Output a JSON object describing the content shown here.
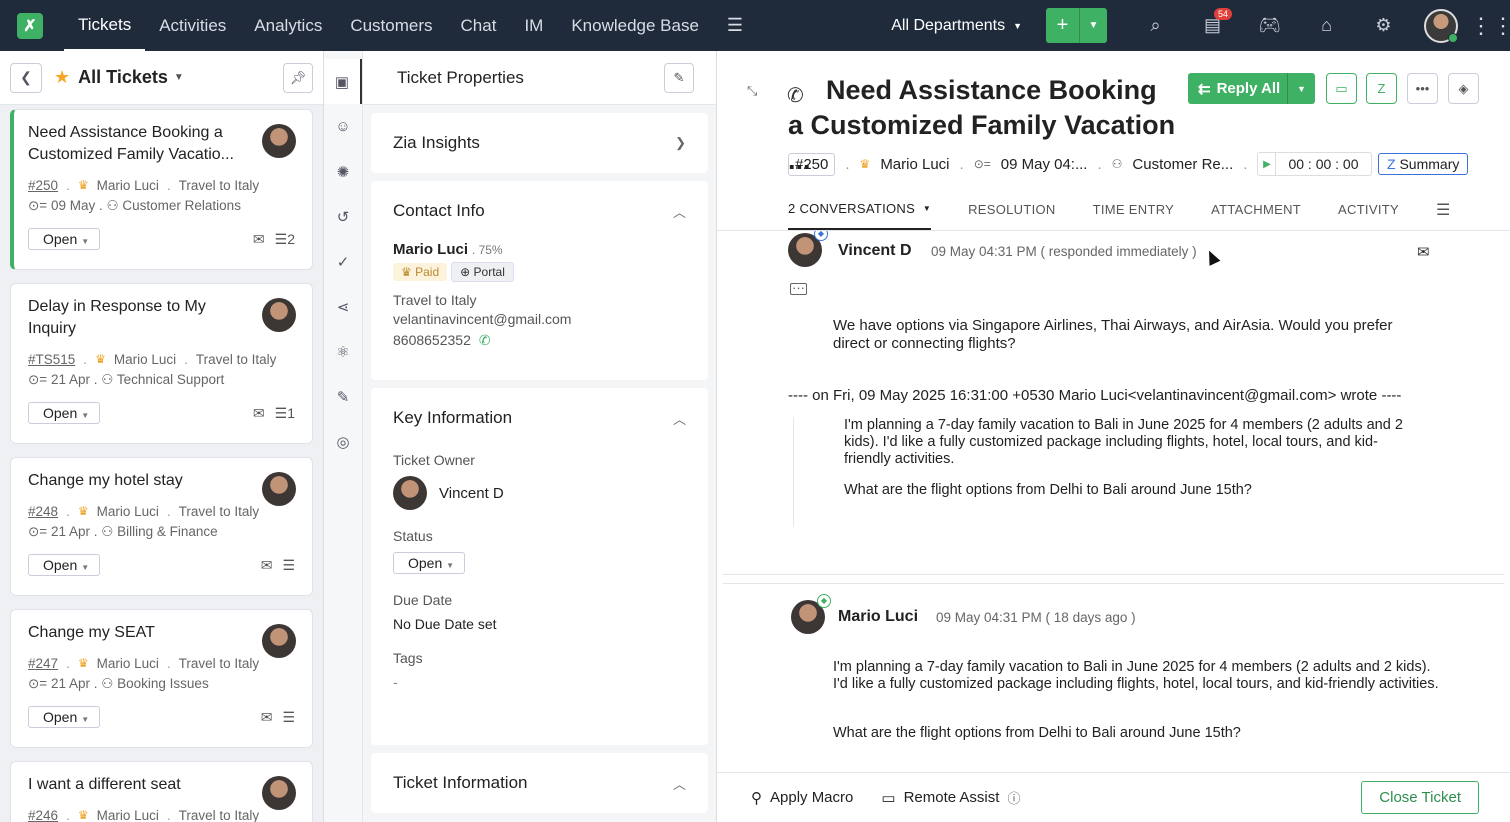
{
  "topbar": {
    "tabs": [
      "Tickets",
      "Activities",
      "Analytics",
      "Customers",
      "Chat",
      "IM",
      "Knowledge Base"
    ],
    "department": "All Departments",
    "notification_count": "54"
  },
  "list": {
    "title": "All Tickets",
    "tickets": [
      {
        "title": "Need Assistance Booking a Customized Family Vacatio...",
        "id": "#250",
        "contact": "Mario Luci",
        "account": "Travel to Italy",
        "date": "09 May",
        "dept": "Customer Relations",
        "status": "Open",
        "count": "2"
      },
      {
        "title": "Delay in Response to My Inquiry",
        "id": "#TS515",
        "contact": "Mario Luci",
        "account": "Travel to Italy",
        "date": "21 Apr",
        "dept": "Technical Support",
        "status": "Open",
        "count": "1"
      },
      {
        "title": "Change my hotel stay",
        "id": "#248",
        "contact": "Mario Luci",
        "account": "Travel to Italy",
        "date": "21 Apr",
        "dept": "Billing & Finance",
        "status": "Open",
        "count": ""
      },
      {
        "title": "Change my SEAT",
        "id": "#247",
        "contact": "Mario Luci",
        "account": "Travel to Italy",
        "date": "21 Apr",
        "dept": "Booking Issues",
        "status": "Open",
        "count": ""
      },
      {
        "title": "I want a different seat",
        "id": "#246",
        "contact": "Mario Luci",
        "account": "Travel to Italy",
        "date": "",
        "dept": "",
        "status": "",
        "count": ""
      }
    ]
  },
  "props": {
    "title": "Ticket Properties",
    "zia": "Zia Insights",
    "contact_header": "Contact Info",
    "contact_name": "Mario Luci",
    "contact_pct": "75%",
    "paid": "Paid",
    "portal": "Portal",
    "account": "Travel to Italy",
    "email": "velantinavincent@gmail.com",
    "phone": "8608652352",
    "key_header": "Key Information",
    "owner_label": "Ticket Owner",
    "owner_name": "Vincent D",
    "status_label": "Status",
    "status_value": "Open",
    "due_label": "Due Date",
    "due_value": "No Due Date set",
    "tags_label": "Tags",
    "tags_value": "-",
    "ticket_info_header": "Ticket Information"
  },
  "ticket": {
    "subject": "Need Assistance Booking a Customized Family Vacation ...",
    "reply_label": "Reply All",
    "id": "#250",
    "contact": "Mario Luci",
    "date": "09 May 04:...",
    "dept": "Customer Re...",
    "timer": "00 : 00 : 00",
    "summary": "Summary",
    "tabs": [
      "2 CONVERSATIONS",
      "RESOLUTION",
      "TIME ENTRY",
      "ATTACHMENT",
      "ACTIVITY"
    ]
  },
  "threads": [
    {
      "author": "Vincent D",
      "time": "09 May 04:31 PM ( responded immediately )",
      "body": "We have options via Singapore Airlines, Thai Airways, and AirAsia. Would you prefer direct or connecting flights?",
      "quote_header": "---- on Fri, 09 May 2025 16:31:00 +0530 Mario Luci<velantinavincent@gmail.com> wrote ----",
      "quote_p1": "I'm planning a 7-day family vacation to Bali in June 2025 for 4 members (2 adults and 2 kids). I'd like a fully customized package including flights, hotel, local tours, and kid-friendly activities.",
      "quote_p2": "What are the flight options from Delhi to Bali around June 15th?"
    },
    {
      "author": "Mario Luci",
      "time": "09 May 04:31 PM ( 18 days ago )",
      "body": "I'm planning a 7-day family vacation to Bali in June 2025 for 4 members (2 adults and 2 kids). I'd like a fully customized package including flights, hotel, local tours, and kid-friendly activities.",
      "body2": "What are the flight options from Delhi to Bali around June 15th?"
    }
  ],
  "footer": {
    "macro": "Apply Macro",
    "remote": "Remote Assist",
    "close": "Close Ticket"
  }
}
